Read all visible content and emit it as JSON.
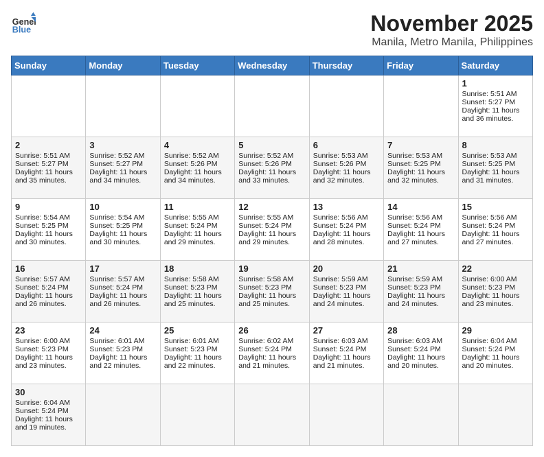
{
  "header": {
    "logo_general": "General",
    "logo_blue": "Blue",
    "title": "November 2025",
    "subtitle": "Manila, Metro Manila, Philippines"
  },
  "days_of_week": [
    "Sunday",
    "Monday",
    "Tuesday",
    "Wednesday",
    "Thursday",
    "Friday",
    "Saturday"
  ],
  "weeks": [
    [
      {
        "day": "",
        "sunrise": "",
        "sunset": "",
        "daylight": ""
      },
      {
        "day": "",
        "sunrise": "",
        "sunset": "",
        "daylight": ""
      },
      {
        "day": "",
        "sunrise": "",
        "sunset": "",
        "daylight": ""
      },
      {
        "day": "",
        "sunrise": "",
        "sunset": "",
        "daylight": ""
      },
      {
        "day": "",
        "sunrise": "",
        "sunset": "",
        "daylight": ""
      },
      {
        "day": "",
        "sunrise": "",
        "sunset": "",
        "daylight": ""
      },
      {
        "day": "1",
        "sunrise": "5:51 AM",
        "sunset": "5:27 PM",
        "daylight": "11 hours and 36 minutes."
      }
    ],
    [
      {
        "day": "2",
        "sunrise": "5:51 AM",
        "sunset": "5:27 PM",
        "daylight": "11 hours and 35 minutes."
      },
      {
        "day": "3",
        "sunrise": "5:52 AM",
        "sunset": "5:27 PM",
        "daylight": "11 hours and 34 minutes."
      },
      {
        "day": "4",
        "sunrise": "5:52 AM",
        "sunset": "5:26 PM",
        "daylight": "11 hours and 34 minutes."
      },
      {
        "day": "5",
        "sunrise": "5:52 AM",
        "sunset": "5:26 PM",
        "daylight": "11 hours and 33 minutes."
      },
      {
        "day": "6",
        "sunrise": "5:53 AM",
        "sunset": "5:26 PM",
        "daylight": "11 hours and 32 minutes."
      },
      {
        "day": "7",
        "sunrise": "5:53 AM",
        "sunset": "5:25 PM",
        "daylight": "11 hours and 32 minutes."
      },
      {
        "day": "8",
        "sunrise": "5:53 AM",
        "sunset": "5:25 PM",
        "daylight": "11 hours and 31 minutes."
      }
    ],
    [
      {
        "day": "9",
        "sunrise": "5:54 AM",
        "sunset": "5:25 PM",
        "daylight": "11 hours and 30 minutes."
      },
      {
        "day": "10",
        "sunrise": "5:54 AM",
        "sunset": "5:25 PM",
        "daylight": "11 hours and 30 minutes."
      },
      {
        "day": "11",
        "sunrise": "5:55 AM",
        "sunset": "5:24 PM",
        "daylight": "11 hours and 29 minutes."
      },
      {
        "day": "12",
        "sunrise": "5:55 AM",
        "sunset": "5:24 PM",
        "daylight": "11 hours and 29 minutes."
      },
      {
        "day": "13",
        "sunrise": "5:56 AM",
        "sunset": "5:24 PM",
        "daylight": "11 hours and 28 minutes."
      },
      {
        "day": "14",
        "sunrise": "5:56 AM",
        "sunset": "5:24 PM",
        "daylight": "11 hours and 27 minutes."
      },
      {
        "day": "15",
        "sunrise": "5:56 AM",
        "sunset": "5:24 PM",
        "daylight": "11 hours and 27 minutes."
      }
    ],
    [
      {
        "day": "16",
        "sunrise": "5:57 AM",
        "sunset": "5:24 PM",
        "daylight": "11 hours and 26 minutes."
      },
      {
        "day": "17",
        "sunrise": "5:57 AM",
        "sunset": "5:24 PM",
        "daylight": "11 hours and 26 minutes."
      },
      {
        "day": "18",
        "sunrise": "5:58 AM",
        "sunset": "5:23 PM",
        "daylight": "11 hours and 25 minutes."
      },
      {
        "day": "19",
        "sunrise": "5:58 AM",
        "sunset": "5:23 PM",
        "daylight": "11 hours and 25 minutes."
      },
      {
        "day": "20",
        "sunrise": "5:59 AM",
        "sunset": "5:23 PM",
        "daylight": "11 hours and 24 minutes."
      },
      {
        "day": "21",
        "sunrise": "5:59 AM",
        "sunset": "5:23 PM",
        "daylight": "11 hours and 24 minutes."
      },
      {
        "day": "22",
        "sunrise": "6:00 AM",
        "sunset": "5:23 PM",
        "daylight": "11 hours and 23 minutes."
      }
    ],
    [
      {
        "day": "23",
        "sunrise": "6:00 AM",
        "sunset": "5:23 PM",
        "daylight": "11 hours and 23 minutes."
      },
      {
        "day": "24",
        "sunrise": "6:01 AM",
        "sunset": "5:23 PM",
        "daylight": "11 hours and 22 minutes."
      },
      {
        "day": "25",
        "sunrise": "6:01 AM",
        "sunset": "5:23 PM",
        "daylight": "11 hours and 22 minutes."
      },
      {
        "day": "26",
        "sunrise": "6:02 AM",
        "sunset": "5:24 PM",
        "daylight": "11 hours and 21 minutes."
      },
      {
        "day": "27",
        "sunrise": "6:03 AM",
        "sunset": "5:24 PM",
        "daylight": "11 hours and 21 minutes."
      },
      {
        "day": "28",
        "sunrise": "6:03 AM",
        "sunset": "5:24 PM",
        "daylight": "11 hours and 20 minutes."
      },
      {
        "day": "29",
        "sunrise": "6:04 AM",
        "sunset": "5:24 PM",
        "daylight": "11 hours and 20 minutes."
      }
    ],
    [
      {
        "day": "30",
        "sunrise": "6:04 AM",
        "sunset": "5:24 PM",
        "daylight": "11 hours and 19 minutes."
      },
      {
        "day": "",
        "sunrise": "",
        "sunset": "",
        "daylight": ""
      },
      {
        "day": "",
        "sunrise": "",
        "sunset": "",
        "daylight": ""
      },
      {
        "day": "",
        "sunrise": "",
        "sunset": "",
        "daylight": ""
      },
      {
        "day": "",
        "sunrise": "",
        "sunset": "",
        "daylight": ""
      },
      {
        "day": "",
        "sunrise": "",
        "sunset": "",
        "daylight": ""
      },
      {
        "day": "",
        "sunrise": "",
        "sunset": "",
        "daylight": ""
      }
    ]
  ],
  "labels": {
    "sunrise": "Sunrise:",
    "sunset": "Sunset:",
    "daylight": "Daylight:"
  }
}
